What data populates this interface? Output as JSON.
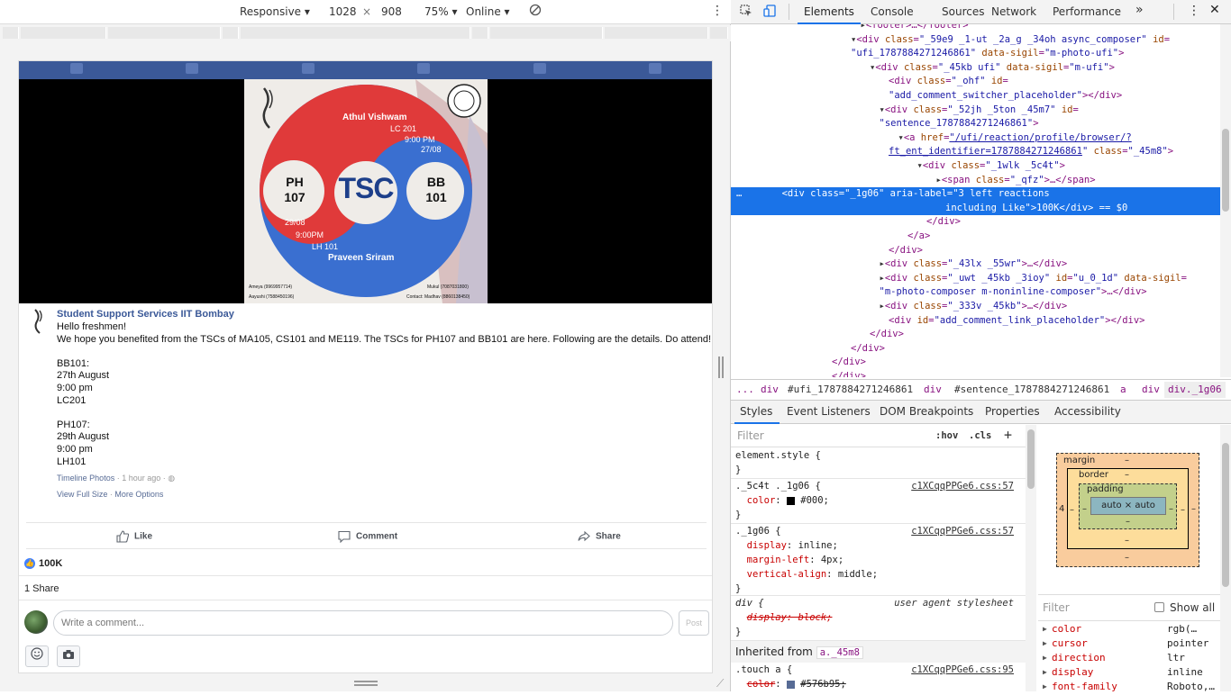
{
  "device_toolbar": {
    "device": "Responsive",
    "width": "1028",
    "times": "×",
    "height": "908",
    "zoom": "75%",
    "network": "Online"
  },
  "facebook": {
    "poster": {
      "title": "TSC",
      "left_course": "PH\n107",
      "right_course": "BB\n101",
      "top_name": "Athul Vishwam",
      "top_venue": "LC 201",
      "top_time": "9:00 PM",
      "top_date": "27/08",
      "bottom_date": "29/08",
      "bottom_time": "9:00PM",
      "bottom_venue": "LH 101",
      "bottom_name": "Praveen Sriram",
      "contact_left_1": "Ameya (9969957714)",
      "contact_left_2": "Aayushi (7588450196)",
      "contact_right_1": "Mukul (7087031800)",
      "contact_right_2": "Contact: Madhav (8860138450)"
    },
    "post": {
      "page_name": "Student Support Services IIT Bombay",
      "text": "Hello freshmen!\nWe hope you benefited from the TSCs of MA105, CS101 and ME119. The TSCs for PH107 and BB101 are here. Following are the details. Do attend!\n\nBB101:\n27th August\n9:00 pm\nLC201\n\nPH107:\n29th August\n9:00 pm\nLH101",
      "album": "Timeline Photos",
      "time": "1 hour ago",
      "view_full": "View Full Size",
      "more_options": "More Options",
      "like": "Like",
      "comment": "Comment",
      "share": "Share",
      "reactions": "100K",
      "shares": "1 Share",
      "comment_placeholder": "Write a comment...",
      "post_button": "Post"
    }
  },
  "devtools": {
    "tabs": [
      "Elements",
      "Console",
      "Sources",
      "Network",
      "Performance",
      "»"
    ],
    "dom_lines": [
      {
        "indent": 13,
        "html": "<span class='pl'>▸</span>&lt;footer&gt;…&lt;/footer&gt;"
      },
      {
        "indent": 12,
        "html": "<span class='pl'>▾</span>&lt;div <span class='attr'>class</span>=<span class='val'>\"_59e9 _1-ut _2a_g _34oh async_composer\"</span> <span class='attr'>id</span>="
      },
      {
        "indent": 12,
        "html": "<span class='val'>\"ufi_1787884271246861\"</span> <span class='attr'>data-sigil</span>=<span class='val'>\"m-photo-ufi\"</span>&gt;"
      },
      {
        "indent": 14,
        "html": "<span class='pl'>▾</span>&lt;div <span class='attr'>class</span>=<span class='val'>\"_45kb ufi\"</span> <span class='attr'>data-sigil</span>=<span class='val'>\"m-ufi\"</span>&gt;"
      },
      {
        "indent": 16,
        "html": "&lt;div <span class='attr'>class</span>=<span class='val'>\"_ohf\"</span> <span class='attr'>id</span>="
      },
      {
        "indent": 16,
        "html": "<span class='val'>\"add_comment_switcher_placeholder\"</span>&gt;&lt;/div&gt;"
      },
      {
        "indent": 15,
        "html": "<span class='pl'>▾</span>&lt;div <span class='attr'>class</span>=<span class='val'>\"_52jh _5ton _45m7\"</span> <span class='attr'>id</span>="
      },
      {
        "indent": 15,
        "html": "<span class='val'>\"sentence_1787884271246861\"</span>&gt;"
      },
      {
        "indent": 17,
        "html": "<span class='pl'>▾</span>&lt;a <span class='attr'>href</span>=<span class='link'>\"/ufi/reaction/profile/browser/?</span>"
      },
      {
        "indent": 16,
        "html": "<span class='link'>ft_ent_identifier=1787884271246861</span><span class='val'>\"</span> <span class='attr'>class</span>=<span class='val'>\"_45m8\"</span>&gt;"
      },
      {
        "indent": 19,
        "html": "<span class='pl'>▾</span>&lt;div <span class='attr'>class</span>=<span class='val'>\"_1wlk _5c4t\"</span>&gt;"
      },
      {
        "indent": 21,
        "html": "<span class='pl'>▸</span>&lt;span <span class='attr'>class</span>=<span class='val'>\"_qfz\"</span>&gt;…&lt;/span&gt;"
      },
      {
        "indent": 0,
        "html": "…       &lt;div class=\"_1g06\" aria-label=\"3 left reactions",
        "selected": true
      },
      {
        "indent": 22,
        "html": "including Like\"&gt;100K&lt;/div&gt; == $0",
        "selected": true
      },
      {
        "indent": 20,
        "html": "&lt;/div&gt;"
      },
      {
        "indent": 18,
        "html": "&lt;/a&gt;"
      },
      {
        "indent": 16,
        "html": "&lt;/div&gt;"
      },
      {
        "indent": 15,
        "html": "<span class='pl'>▸</span>&lt;div <span class='attr'>class</span>=<span class='val'>\"_43lx _55wr\"</span>&gt;…&lt;/div&gt;"
      },
      {
        "indent": 15,
        "html": "<span class='pl'>▸</span>&lt;div <span class='attr'>class</span>=<span class='val'>\"_uwt _45kb _3ioy\"</span> <span class='attr'>id</span>=<span class='val'>\"u_0_1d\"</span> <span class='attr'>data-sigil</span>="
      },
      {
        "indent": 15,
        "html": "<span class='val'>\"m-photo-composer m-noninline-composer\"</span>&gt;…&lt;/div&gt;"
      },
      {
        "indent": 15,
        "html": "<span class='pl'>▸</span>&lt;div <span class='attr'>class</span>=<span class='val'>\"_333v _45kb\"</span>&gt;…&lt;/div&gt;"
      },
      {
        "indent": 16,
        "html": "&lt;div <span class='attr'>id</span>=<span class='val'>\"add_comment_link_placeholder\"</span>&gt;&lt;/div&gt;"
      },
      {
        "indent": 14,
        "html": "&lt;/div&gt;"
      },
      {
        "indent": 12,
        "html": "&lt;/div&gt;"
      },
      {
        "indent": 10,
        "html": "&lt;/div&gt;"
      },
      {
        "indent": 10,
        "html": "&lt;/div&gt;"
      }
    ],
    "breadcrumbs": [
      "...",
      "div",
      "#ufi_1787884271246861",
      "div",
      "#sentence_1787884271246861",
      "a",
      "div",
      "div._1g06"
    ],
    "subtabs": [
      "Styles",
      "Event Listeners",
      "DOM Breakpoints",
      "Properties",
      "Accessibility"
    ],
    "styles": {
      "filter_placeholder": "Filter",
      "hov": ":hov",
      "cls": ".cls",
      "plus": "+",
      "inherited_label": "Inherited from",
      "inherited_tag": "a._45m8"
    },
    "boxmodel": {
      "margin": "margin",
      "border": "border",
      "padding": "padding",
      "dash": "–",
      "content": "auto × auto",
      "left_val": "4"
    },
    "computed": {
      "filter_placeholder": "Filter",
      "show_all": "Show all",
      "rows": [
        {
          "k": "color",
          "v": "rgb(…"
        },
        {
          "k": "cursor",
          "v": "pointer"
        },
        {
          "k": "direction",
          "v": "ltr"
        },
        {
          "k": "display",
          "v": "inline"
        },
        {
          "k": "font-family",
          "v": "Roboto,…"
        }
      ]
    }
  }
}
